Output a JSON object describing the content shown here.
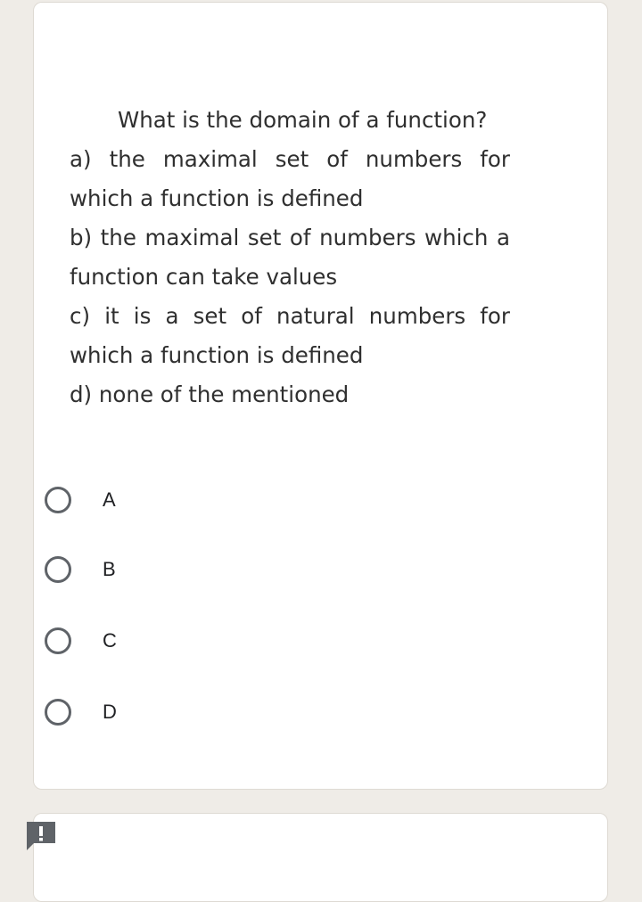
{
  "question": {
    "stem": "What is the domain of a function?",
    "options_text": [
      "a) the maximal set of numbers for which a function is defined",
      "b) the maximal set of numbers which a function can take values",
      "c) it is a set of natural numbers for which a function is defined",
      "d) none of the mentioned"
    ]
  },
  "choices": [
    {
      "label": "A",
      "selected": false
    },
    {
      "label": "B",
      "selected": false
    },
    {
      "label": "C",
      "selected": false
    },
    {
      "label": "D",
      "selected": false
    }
  ],
  "colors": {
    "page_background": "#efece7",
    "card_background": "#ffffff",
    "radio_border": "#5f6368",
    "alert_icon": "#5f6368"
  },
  "icons": {
    "alert": "alert-exclamation-icon"
  }
}
